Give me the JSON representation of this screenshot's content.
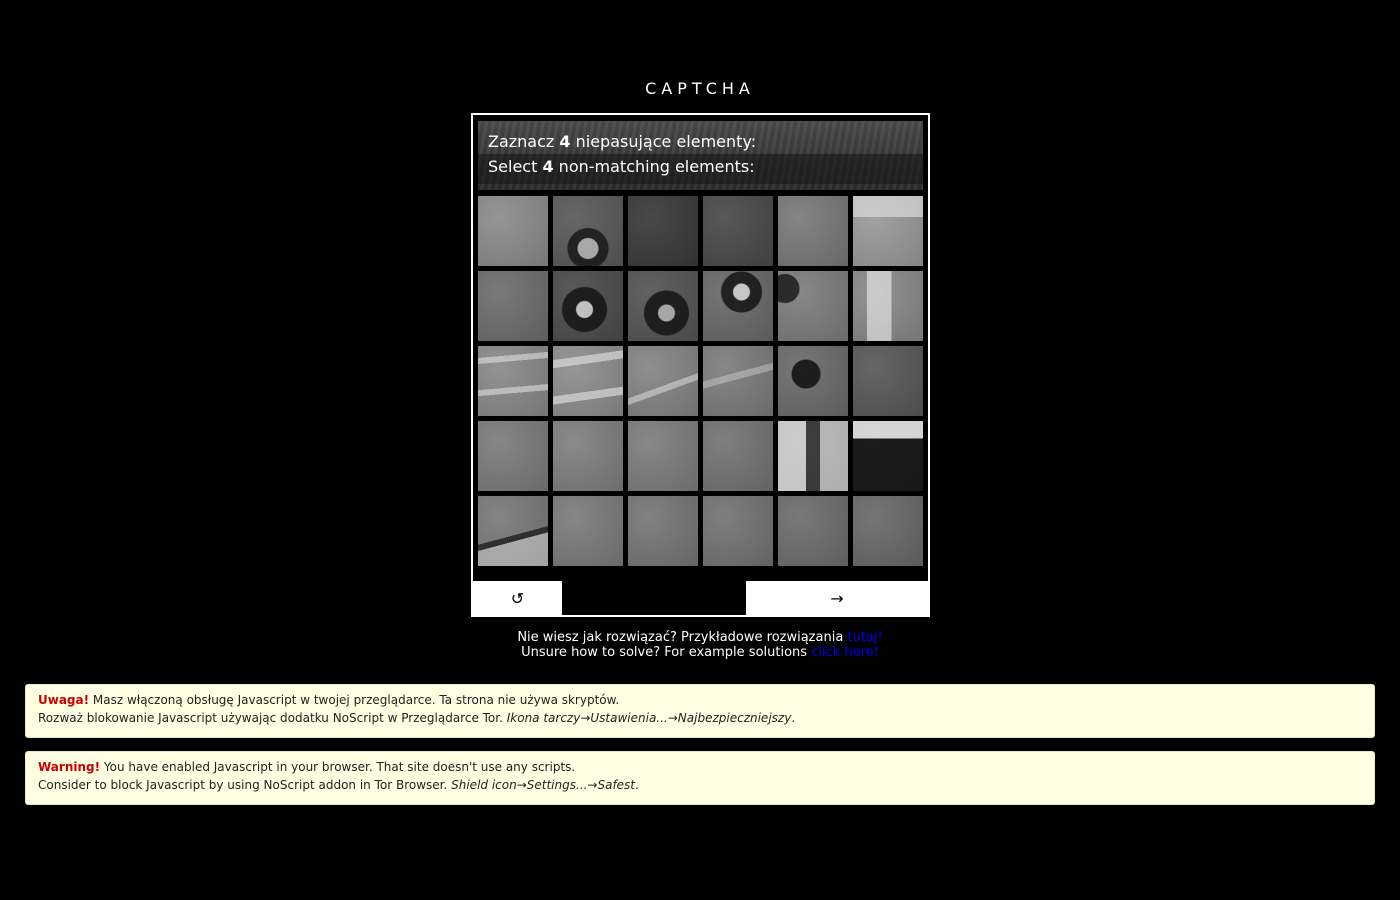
{
  "captcha": {
    "title": "CAPTCHA",
    "instruction_pl": {
      "prefix": "Zaznacz ",
      "count": "4",
      "suffix": " niepasujące elementy:"
    },
    "instruction_en": {
      "prefix": "Select ",
      "count": "4",
      "suffix": " non-matching elements:"
    },
    "grid": {
      "rows": 5,
      "cols": 6,
      "tile_count": 30
    },
    "reload_button": "↺",
    "next_button": "→"
  },
  "help": {
    "pl_text": "Nie wiesz jak rozwiązać? Przykładowe rozwiązania ",
    "pl_link": "tutaj!",
    "en_text": "Unsure how to solve? For example solutions ",
    "en_link": "click here!",
    "link_color": "#0000ee"
  },
  "warnings": [
    {
      "label": "Uwaga!",
      "line1": " Masz włączoną obsługę Javascript w twojej przeglądarce. Ta strona nie używa skryptów.",
      "line2": "Rozważ blokowanie Javascript używając dodatku NoScript w Przeglądarce Tor. ",
      "line2_italic": "Ikona tarczy→Ustawienia...→Najbezpieczniejszy",
      "line2_end": "."
    },
    {
      "label": "Warning!",
      "line1": " You have enabled Javascript in your browser. That site doesn't use any scripts.",
      "line2": "Consider to block Javascript by using NoScript addon in Tor Browser. ",
      "line2_italic": "Shield icon→Settings...→Safest",
      "line2_end": "."
    }
  ],
  "colors": {
    "background": "#000000",
    "warning_bg": "#ffffe3",
    "warning_label": "#cc0000"
  }
}
